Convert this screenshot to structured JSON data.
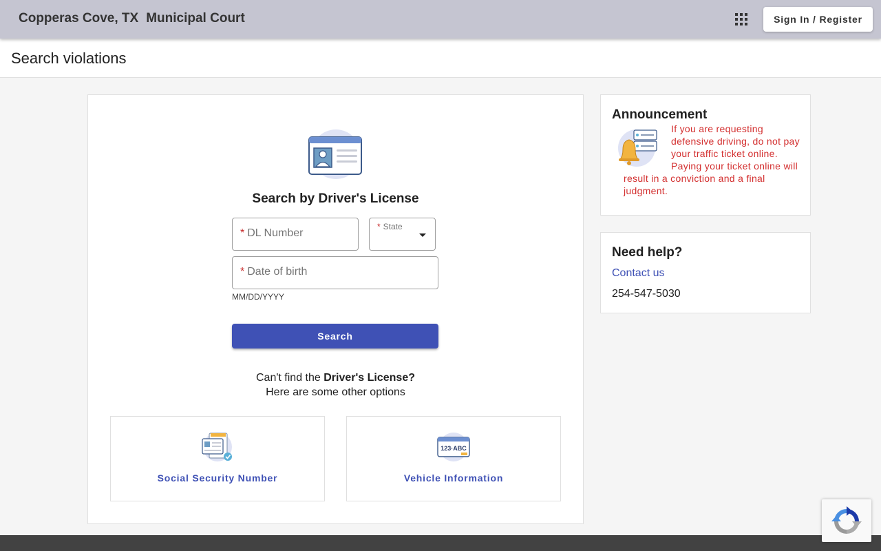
{
  "header": {
    "city": "Copperas Cove, TX",
    "court": "Municipal Court",
    "signin_label": "Sign In / Register",
    "apps_icon": "apps-grid-icon"
  },
  "page": {
    "title": "Search violations"
  },
  "search": {
    "heading": "Search by Driver's License",
    "license_icon": "drivers-license-icon",
    "required_mark": "*",
    "dl_label": "DL Number",
    "dl_value": "",
    "state_label": "State",
    "state_value": "",
    "dob_label": "Date of birth",
    "dob_value": "",
    "dob_hint": "MM/DD/YYYY",
    "button_label": "Search"
  },
  "options": {
    "prefix": "Can't find the ",
    "bold": "Driver's License?",
    "line2": "Here are some other options",
    "items": [
      {
        "label": "Social Security Number",
        "icon": "ssn-card-icon"
      },
      {
        "label": "Vehicle Information",
        "icon": "license-plate-icon"
      }
    ]
  },
  "announcement": {
    "title": "Announcement",
    "icon": "bell-icon",
    "text": "If you are requesting defensive driving, do not pay your traffic ticket online.  Paying your ticket online will result in a conviction and a final judgment."
  },
  "help": {
    "title": "Need help?",
    "contact_label": "Contact us",
    "phone": "254-547-5030"
  },
  "colors": {
    "header_bg": "#c5c5d1",
    "primary": "#3f51b5",
    "announcement_text": "#d32f2f",
    "required": "#c62828",
    "footer": "#424242"
  }
}
